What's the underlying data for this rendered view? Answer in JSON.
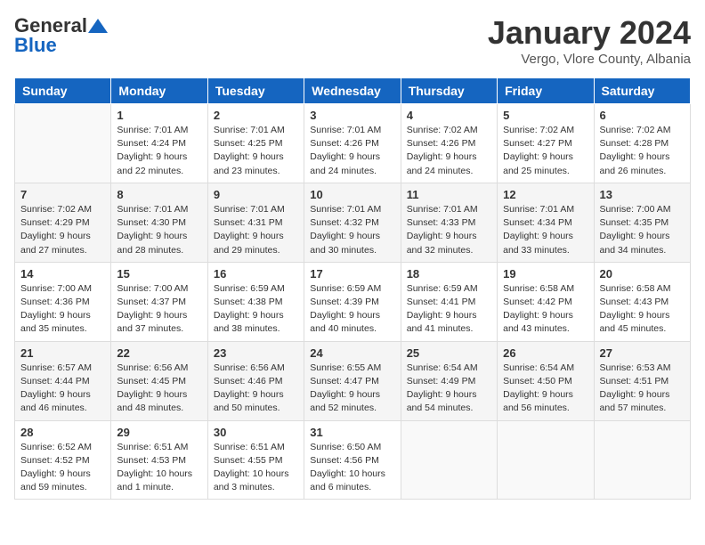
{
  "header": {
    "logo_general": "General",
    "logo_blue": "Blue",
    "title": "January 2024",
    "location": "Vergo, Vlore County, Albania"
  },
  "days_of_week": [
    "Sunday",
    "Monday",
    "Tuesday",
    "Wednesday",
    "Thursday",
    "Friday",
    "Saturday"
  ],
  "weeks": [
    [
      {
        "day": "",
        "sunrise": "",
        "sunset": "",
        "daylight": ""
      },
      {
        "day": "1",
        "sunrise": "Sunrise: 7:01 AM",
        "sunset": "Sunset: 4:24 PM",
        "daylight": "Daylight: 9 hours and 22 minutes."
      },
      {
        "day": "2",
        "sunrise": "Sunrise: 7:01 AM",
        "sunset": "Sunset: 4:25 PM",
        "daylight": "Daylight: 9 hours and 23 minutes."
      },
      {
        "day": "3",
        "sunrise": "Sunrise: 7:01 AM",
        "sunset": "Sunset: 4:26 PM",
        "daylight": "Daylight: 9 hours and 24 minutes."
      },
      {
        "day": "4",
        "sunrise": "Sunrise: 7:02 AM",
        "sunset": "Sunset: 4:26 PM",
        "daylight": "Daylight: 9 hours and 24 minutes."
      },
      {
        "day": "5",
        "sunrise": "Sunrise: 7:02 AM",
        "sunset": "Sunset: 4:27 PM",
        "daylight": "Daylight: 9 hours and 25 minutes."
      },
      {
        "day": "6",
        "sunrise": "Sunrise: 7:02 AM",
        "sunset": "Sunset: 4:28 PM",
        "daylight": "Daylight: 9 hours and 26 minutes."
      }
    ],
    [
      {
        "day": "7",
        "sunrise": "Sunrise: 7:02 AM",
        "sunset": "Sunset: 4:29 PM",
        "daylight": "Daylight: 9 hours and 27 minutes."
      },
      {
        "day": "8",
        "sunrise": "Sunrise: 7:01 AM",
        "sunset": "Sunset: 4:30 PM",
        "daylight": "Daylight: 9 hours and 28 minutes."
      },
      {
        "day": "9",
        "sunrise": "Sunrise: 7:01 AM",
        "sunset": "Sunset: 4:31 PM",
        "daylight": "Daylight: 9 hours and 29 minutes."
      },
      {
        "day": "10",
        "sunrise": "Sunrise: 7:01 AM",
        "sunset": "Sunset: 4:32 PM",
        "daylight": "Daylight: 9 hours and 30 minutes."
      },
      {
        "day": "11",
        "sunrise": "Sunrise: 7:01 AM",
        "sunset": "Sunset: 4:33 PM",
        "daylight": "Daylight: 9 hours and 32 minutes."
      },
      {
        "day": "12",
        "sunrise": "Sunrise: 7:01 AM",
        "sunset": "Sunset: 4:34 PM",
        "daylight": "Daylight: 9 hours and 33 minutes."
      },
      {
        "day": "13",
        "sunrise": "Sunrise: 7:00 AM",
        "sunset": "Sunset: 4:35 PM",
        "daylight": "Daylight: 9 hours and 34 minutes."
      }
    ],
    [
      {
        "day": "14",
        "sunrise": "Sunrise: 7:00 AM",
        "sunset": "Sunset: 4:36 PM",
        "daylight": "Daylight: 9 hours and 35 minutes."
      },
      {
        "day": "15",
        "sunrise": "Sunrise: 7:00 AM",
        "sunset": "Sunset: 4:37 PM",
        "daylight": "Daylight: 9 hours and 37 minutes."
      },
      {
        "day": "16",
        "sunrise": "Sunrise: 6:59 AM",
        "sunset": "Sunset: 4:38 PM",
        "daylight": "Daylight: 9 hours and 38 minutes."
      },
      {
        "day": "17",
        "sunrise": "Sunrise: 6:59 AM",
        "sunset": "Sunset: 4:39 PM",
        "daylight": "Daylight: 9 hours and 40 minutes."
      },
      {
        "day": "18",
        "sunrise": "Sunrise: 6:59 AM",
        "sunset": "Sunset: 4:41 PM",
        "daylight": "Daylight: 9 hours and 41 minutes."
      },
      {
        "day": "19",
        "sunrise": "Sunrise: 6:58 AM",
        "sunset": "Sunset: 4:42 PM",
        "daylight": "Daylight: 9 hours and 43 minutes."
      },
      {
        "day": "20",
        "sunrise": "Sunrise: 6:58 AM",
        "sunset": "Sunset: 4:43 PM",
        "daylight": "Daylight: 9 hours and 45 minutes."
      }
    ],
    [
      {
        "day": "21",
        "sunrise": "Sunrise: 6:57 AM",
        "sunset": "Sunset: 4:44 PM",
        "daylight": "Daylight: 9 hours and 46 minutes."
      },
      {
        "day": "22",
        "sunrise": "Sunrise: 6:56 AM",
        "sunset": "Sunset: 4:45 PM",
        "daylight": "Daylight: 9 hours and 48 minutes."
      },
      {
        "day": "23",
        "sunrise": "Sunrise: 6:56 AM",
        "sunset": "Sunset: 4:46 PM",
        "daylight": "Daylight: 9 hours and 50 minutes."
      },
      {
        "day": "24",
        "sunrise": "Sunrise: 6:55 AM",
        "sunset": "Sunset: 4:47 PM",
        "daylight": "Daylight: 9 hours and 52 minutes."
      },
      {
        "day": "25",
        "sunrise": "Sunrise: 6:54 AM",
        "sunset": "Sunset: 4:49 PM",
        "daylight": "Daylight: 9 hours and 54 minutes."
      },
      {
        "day": "26",
        "sunrise": "Sunrise: 6:54 AM",
        "sunset": "Sunset: 4:50 PM",
        "daylight": "Daylight: 9 hours and 56 minutes."
      },
      {
        "day": "27",
        "sunrise": "Sunrise: 6:53 AM",
        "sunset": "Sunset: 4:51 PM",
        "daylight": "Daylight: 9 hours and 57 minutes."
      }
    ],
    [
      {
        "day": "28",
        "sunrise": "Sunrise: 6:52 AM",
        "sunset": "Sunset: 4:52 PM",
        "daylight": "Daylight: 9 hours and 59 minutes."
      },
      {
        "day": "29",
        "sunrise": "Sunrise: 6:51 AM",
        "sunset": "Sunset: 4:53 PM",
        "daylight": "Daylight: 10 hours and 1 minute."
      },
      {
        "day": "30",
        "sunrise": "Sunrise: 6:51 AM",
        "sunset": "Sunset: 4:55 PM",
        "daylight": "Daylight: 10 hours and 3 minutes."
      },
      {
        "day": "31",
        "sunrise": "Sunrise: 6:50 AM",
        "sunset": "Sunset: 4:56 PM",
        "daylight": "Daylight: 10 hours and 6 minutes."
      },
      {
        "day": "",
        "sunrise": "",
        "sunset": "",
        "daylight": ""
      },
      {
        "day": "",
        "sunrise": "",
        "sunset": "",
        "daylight": ""
      },
      {
        "day": "",
        "sunrise": "",
        "sunset": "",
        "daylight": ""
      }
    ]
  ]
}
